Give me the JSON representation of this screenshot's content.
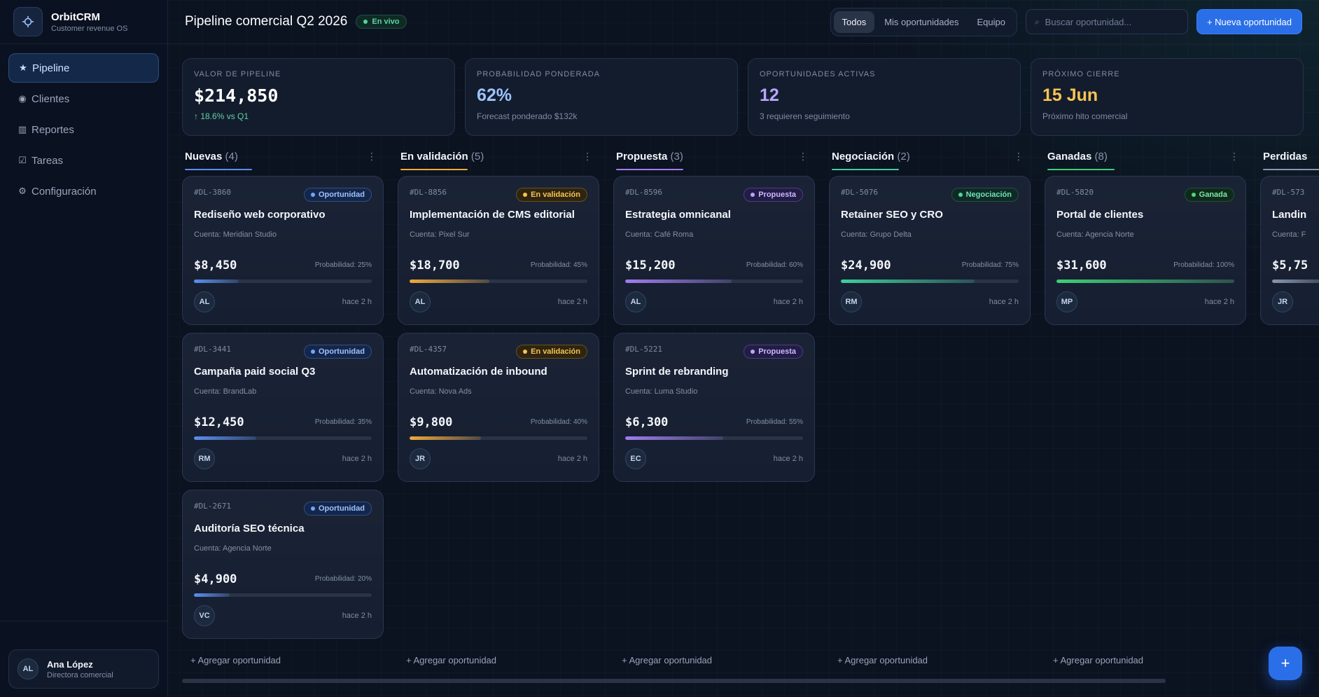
{
  "brand": {
    "name": "OrbitCRM",
    "tagline": "Customer revenue OS"
  },
  "sidebar": {
    "items": [
      {
        "label": "Pipeline",
        "icon": "★",
        "icon_name": "star-icon",
        "active": true
      },
      {
        "label": "Clientes",
        "icon": "◉",
        "icon_name": "clients-icon",
        "active": false
      },
      {
        "label": "Reportes",
        "icon": "▥",
        "icon_name": "reports-icon",
        "active": false
      },
      {
        "label": "Tareas",
        "icon": "☑",
        "icon_name": "tasks-icon",
        "active": false
      },
      {
        "label": "Configuración",
        "icon": "⚙",
        "icon_name": "gear-icon",
        "active": false
      }
    ]
  },
  "user": {
    "initials": "AL",
    "name": "Ana López",
    "role": "Directora comercial"
  },
  "header": {
    "title": "Pipeline comercial Q2 2026",
    "live_badge": "En vivo",
    "filters": [
      "Todos",
      "Mis oportunidades",
      "Equipo"
    ],
    "active_filter": 0,
    "search_icon": "⌕",
    "search_placeholder": "Buscar oportunidad...",
    "new_button": "+ Nueva oportunidad"
  },
  "stats": [
    {
      "label": "Valor de pipeline",
      "value": "$214,850",
      "sub": "↑ 18.6% vs Q1",
      "value_color": "#ffffff",
      "sub_color": "#5fd3a8",
      "mono": true
    },
    {
      "label": "Probabilidad ponderada",
      "value": "62%",
      "sub": "Forecast ponderado $132k",
      "value_color": "#9cc3ff",
      "sub_color": "#7f8ca4",
      "mono": false
    },
    {
      "label": "Oportunidades activas",
      "value": "12",
      "sub": "3 requieren seguimiento",
      "value_color": "#b7a6ff",
      "sub_color": "#7f8ca4",
      "mono": false
    },
    {
      "label": "Próximo cierre",
      "value": "15 Jun",
      "sub": "Próximo hito comercial",
      "value_color": "#f6c453",
      "sub_color": "#7f8ca4",
      "mono": false
    }
  ],
  "columns": [
    {
      "title": "Nuevas",
      "count": "(4)",
      "color": "#5b8ff0",
      "cards": [
        {
          "id": "#DL-3860",
          "status": "Oportunidad",
          "title": "Rediseño web corporativo",
          "account": "Cuenta: Meridian Studio",
          "amount": "$8,450",
          "probability_label": "Probabilidad: 25%",
          "probability": 25,
          "owner": "AL",
          "time": "hace 2 h"
        },
        {
          "id": "#DL-3441",
          "status": "Oportunidad",
          "title": "Campaña paid social Q3",
          "account": "Cuenta: BrandLab",
          "amount": "$12,450",
          "probability_label": "Probabilidad: 35%",
          "probability": 35,
          "owner": "RM",
          "time": "hace 2 h"
        },
        {
          "id": "#DL-2671",
          "status": "Oportunidad",
          "title": "Auditoría SEO técnica",
          "account": "Cuenta: Agencia Norte",
          "amount": "$4,900",
          "probability_label": "Probabilidad: 20%",
          "probability": 20,
          "owner": "VC",
          "time": "hace 2 h"
        }
      ]
    },
    {
      "title": "En validación",
      "count": "(5)",
      "color": "#f0a93a",
      "cards": [
        {
          "id": "#DL-8856",
          "status": "En validación",
          "title": "Implementación de CMS editorial",
          "account": "Cuenta: Pixel Sur",
          "amount": "$18,700",
          "probability_label": "Probabilidad: 45%",
          "probability": 45,
          "owner": "AL",
          "time": "hace 2 h"
        },
        {
          "id": "#DL-4357",
          "status": "En validación",
          "title": "Automatización de inbound",
          "account": "Cuenta: Nova Ads",
          "amount": "$9,800",
          "probability_label": "Probabilidad: 40%",
          "probability": 40,
          "owner": "JR",
          "time": "hace 2 h"
        }
      ]
    },
    {
      "title": "Propuesta",
      "count": "(3)",
      "color": "#a27cf0",
      "cards": [
        {
          "id": "#DL-8596",
          "status": "Propuesta",
          "title": "Estrategia omnicanal",
          "account": "Cuenta: Café Roma",
          "amount": "$15,200",
          "probability_label": "Probabilidad: 60%",
          "probability": 60,
          "owner": "AL",
          "time": "hace 2 h"
        },
        {
          "id": "#DL-5221",
          "status": "Propuesta",
          "title": "Sprint de rebranding",
          "account": "Cuenta: Luma Studio",
          "amount": "$6,300",
          "probability_label": "Probabilidad: 55%",
          "probability": 55,
          "owner": "EC",
          "time": "hace 2 h"
        }
      ]
    },
    {
      "title": "Negociación",
      "count": "(2)",
      "color": "#3fcf9a",
      "cards": [
        {
          "id": "#DL-5076",
          "status": "Negociación",
          "title": "Retainer SEO y CRO",
          "account": "Cuenta: Grupo Delta",
          "amount": "$24,900",
          "probability_label": "Probabilidad: 75%",
          "probability": 75,
          "owner": "RM",
          "time": "hace 2 h"
        }
      ]
    },
    {
      "title": "Ganadas",
      "count": "(8)",
      "color": "#3ecf74",
      "cards": [
        {
          "id": "#DL-5820",
          "status": "Ganada",
          "title": "Portal de clientes",
          "account": "Cuenta: Agencia Norte",
          "amount": "$31,600",
          "probability_label": "Probabilidad: 100%",
          "probability": 100,
          "owner": "MP",
          "time": "hace 2 h"
        }
      ]
    },
    {
      "title": "Perdidas",
      "count": "",
      "color": "#8a96ad",
      "cards": [
        {
          "id": "#DL-573",
          "status": "",
          "title": "Landin",
          "account": "Cuenta: F",
          "amount": "$5,75",
          "probability_label": "",
          "probability": 30,
          "owner": "JR",
          "time": ""
        }
      ]
    }
  ],
  "add_label": "+ Agregar oportunidad",
  "fab_label": "+",
  "status_colors": {
    "Oportunidad": {
      "bg": "#14264a",
      "border": "#2f4f86",
      "fg": "#9cc3ff",
      "dot": "#6ea8ff"
    },
    "En validación": {
      "bg": "#2e2410",
      "border": "#6b4f1b",
      "fg": "#f6c453",
      "dot": "#f6c453"
    },
    "Propuesta": {
      "bg": "#231c45",
      "border": "#4a3d86",
      "fg": "#c9b8ff",
      "dot": "#b7a6ff"
    },
    "Negociación": {
      "bg": "#0f2a24",
      "border": "#1f5144",
      "fg": "#6ee3b6",
      "dot": "#4fd6a0"
    },
    "Ganada": {
      "bg": "#0f2a1c",
      "border": "#1f5134",
      "fg": "#7ce8a4",
      "dot": "#4fd67c"
    }
  }
}
